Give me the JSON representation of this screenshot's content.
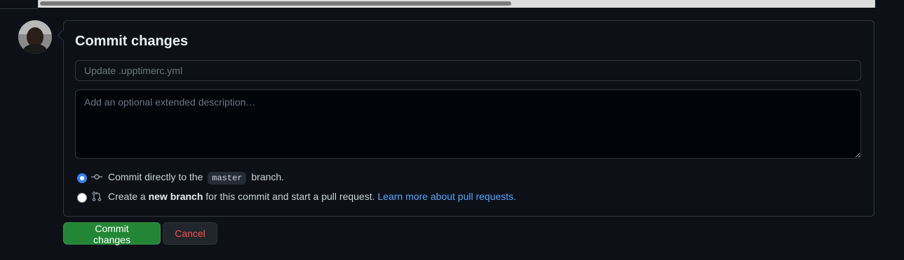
{
  "commit_form": {
    "title": "Commit changes",
    "summary_placeholder": "Update .upptimerc.yml",
    "description_placeholder": "Add an optional extended description…",
    "options": {
      "direct": {
        "selected": true,
        "text_before": "Commit directly to the",
        "branch": "master",
        "text_after": "branch."
      },
      "new_branch": {
        "selected": false,
        "text_before": "Create a",
        "bold": "new branch",
        "text_after": "for this commit and start a pull request.",
        "link": "Learn more about pull requests."
      }
    },
    "buttons": {
      "commit": "Commit changes",
      "cancel": "Cancel"
    }
  },
  "colors": {
    "background": "#0d1117",
    "primary_button": "#238636",
    "link": "#58a6ff",
    "danger_text": "#f85149"
  },
  "icons": {
    "direct": "git-commit-icon",
    "new_branch": "git-pull-request-icon"
  }
}
